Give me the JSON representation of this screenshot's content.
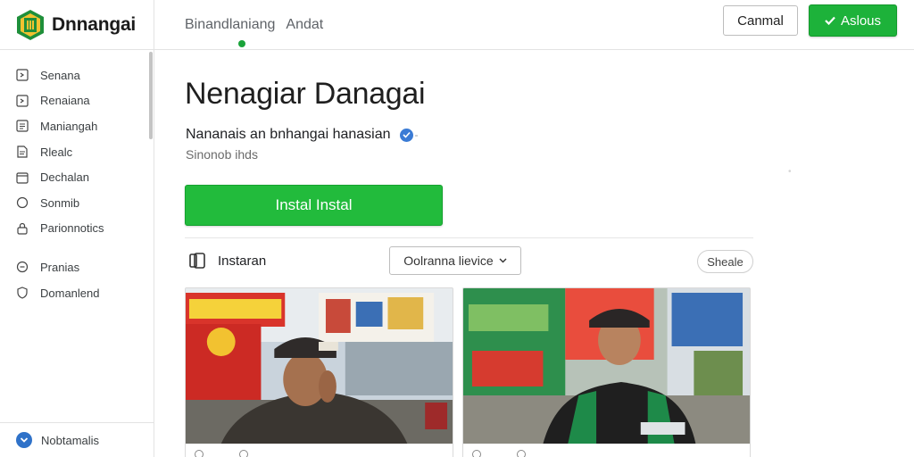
{
  "header": {
    "brand_name": "Dnnangai",
    "breadcrumbs": [
      "Binandlaniang",
      "Andat"
    ],
    "cancel_label": "Canmal",
    "primary_label": "Aslous",
    "primary_icon": "check-icon"
  },
  "sidebar": {
    "items": [
      {
        "label": "Senana",
        "icon": "square-arrow-icon"
      },
      {
        "label": "Renaiana",
        "icon": "square-arrow-icon"
      },
      {
        "label": "Maniangah",
        "icon": "list-icon"
      },
      {
        "label": "Rlealc",
        "icon": "document-icon"
      },
      {
        "label": "Dechalan",
        "icon": "calendar-icon"
      },
      {
        "label": "Sonmib",
        "icon": "circle-icon"
      },
      {
        "label": "Parionnotics",
        "icon": "lock-icon"
      }
    ],
    "secondary_items": [
      {
        "label": "Pranias",
        "icon": "circle-minus-icon"
      },
      {
        "label": "Domanlend",
        "icon": "shield-icon"
      }
    ],
    "footer_label": "Nobtamalis",
    "footer_icon": "chevron-down-circle-icon"
  },
  "main": {
    "title": "Nenagiar Danagai",
    "subtitle": "Nananais an bnhangai hanasian",
    "subtitle_suffix": "-",
    "meta": "Sinonob ihds",
    "faint_mark": "•",
    "install_label": "Instal Instal",
    "section_label": "Instaran",
    "device_select": "Oolranna lievice",
    "share_label": "Sheale"
  },
  "colors": {
    "accent_green": "#1db23a",
    "verified_blue": "#3a7bd5",
    "border_gray": "#e3e3e3"
  }
}
